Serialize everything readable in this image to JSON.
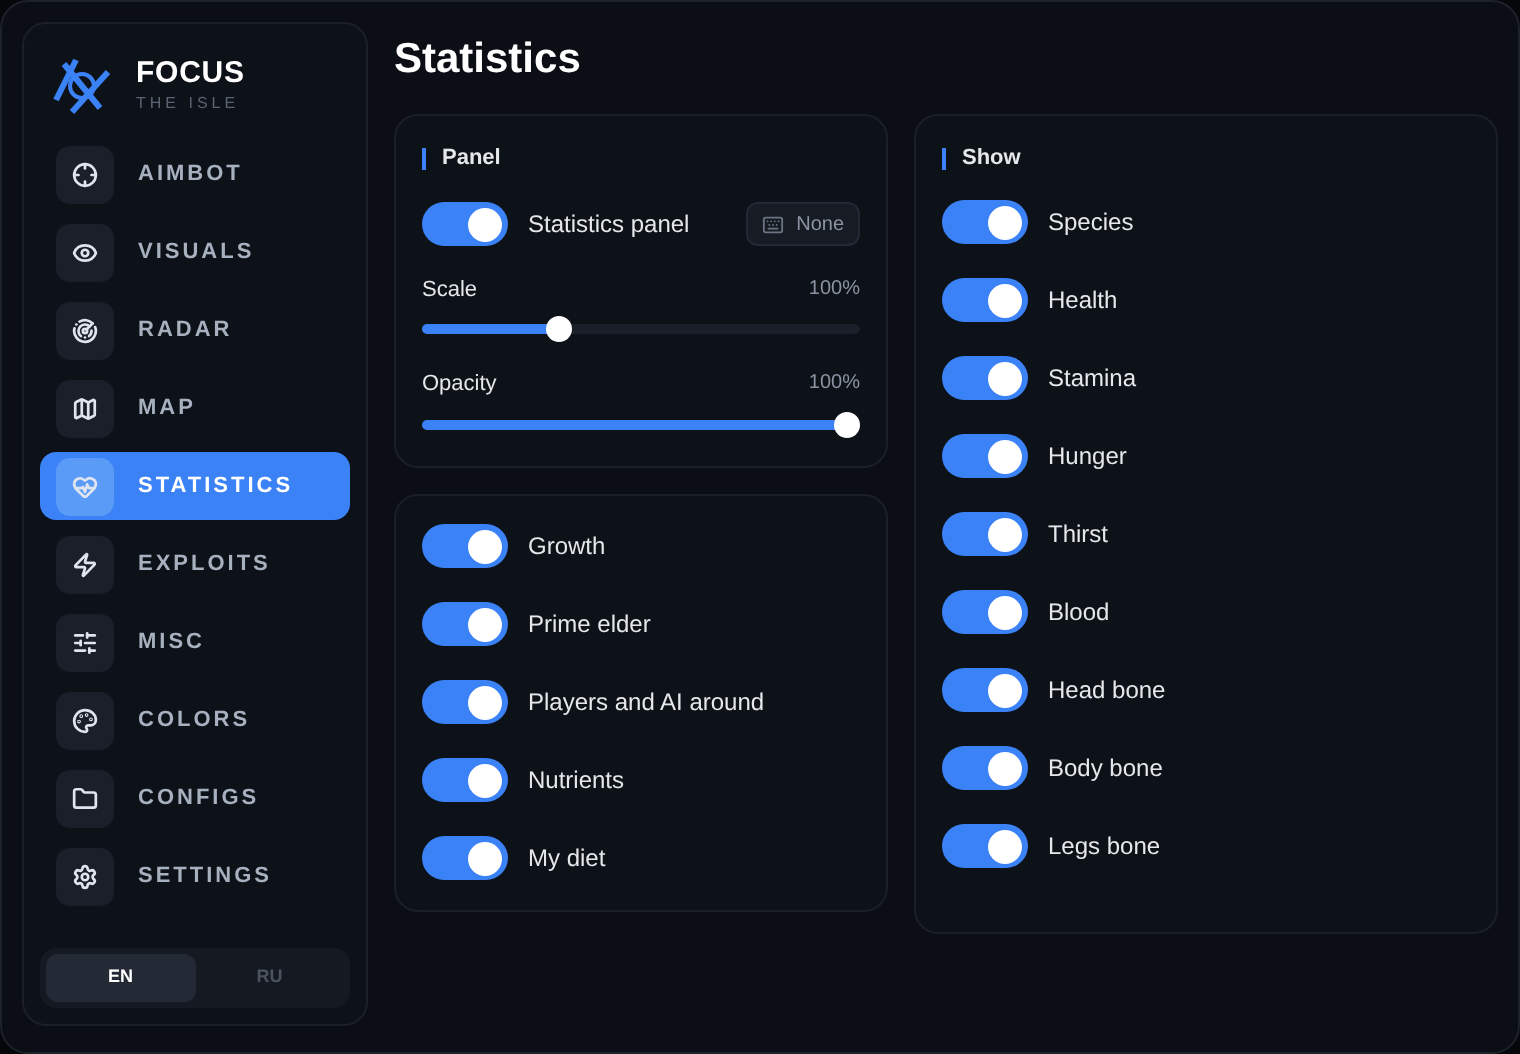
{
  "brand": {
    "name": "FOCUS",
    "subtitle": "THE ISLE"
  },
  "nav": [
    {
      "label": "AIMBOT",
      "selected": false
    },
    {
      "label": "VISUALS",
      "selected": false
    },
    {
      "label": "RADAR",
      "selected": false
    },
    {
      "label": "MAP",
      "selected": false
    },
    {
      "label": "STATISTICS",
      "selected": true
    },
    {
      "label": "EXPLOITS",
      "selected": false
    },
    {
      "label": "MISC",
      "selected": false
    },
    {
      "label": "COLORS",
      "selected": false
    },
    {
      "label": "CONFIGS",
      "selected": false
    },
    {
      "label": "SETTINGS",
      "selected": false
    }
  ],
  "languages": [
    {
      "label": "EN",
      "selected": true
    },
    {
      "label": "RU",
      "selected": false
    }
  ],
  "title": "Statistics",
  "panel": {
    "title": "Panel",
    "toggle": {
      "label": "Statistics panel",
      "on": true
    },
    "keybind": "None",
    "sliders": [
      {
        "label": "Scale",
        "reading": "100%",
        "level": 0.3
      },
      {
        "label": "Opacity",
        "reading": "100%",
        "level": 1
      }
    ]
  },
  "extras": [
    {
      "label": "Growth",
      "on": true
    },
    {
      "label": "Prime elder",
      "on": true
    },
    {
      "label": "Players and AI around",
      "on": true
    },
    {
      "label": "Nutrients",
      "on": true
    },
    {
      "label": "My diet",
      "on": true
    }
  ],
  "show": {
    "title": "Show",
    "items": [
      {
        "label": "Species",
        "on": true
      },
      {
        "label": "Health",
        "on": true
      },
      {
        "label": "Stamina",
        "on": true
      },
      {
        "label": "Hunger",
        "on": true
      },
      {
        "label": "Thirst",
        "on": true
      },
      {
        "label": "Blood",
        "on": true
      },
      {
        "label": "Head bone",
        "on": true
      },
      {
        "label": "Body bone",
        "on": true
      },
      {
        "label": "Legs bone",
        "on": true
      }
    ]
  }
}
